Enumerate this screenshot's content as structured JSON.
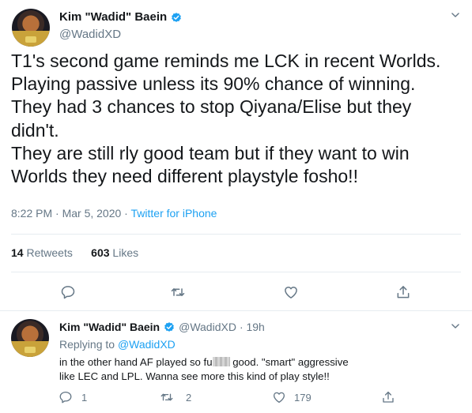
{
  "main_tweet": {
    "author": {
      "display_name": "Kim \"Wadid\" Baein",
      "handle": "@WadidXD",
      "verified": true
    },
    "text_lines": [
      "T1's second game reminds me LCK in recent Worlds.",
      "Playing passive unless its 90% chance of winning.",
      "They had 3 chances to stop Qiyana/Elise but they didn't.",
      "They are still rly good team but if they want to win Worlds they need different playstyle fosho!!"
    ],
    "time": "8:22 PM · Mar 5, 2020",
    "separator": " · ",
    "source": "Twitter for iPhone",
    "retweets_count": "14",
    "retweets_label": "Retweets",
    "likes_count": "603",
    "likes_label": "Likes"
  },
  "reply_tweet": {
    "author": {
      "display_name": "Kim \"Wadid\" Baein",
      "handle": "@WadidXD",
      "verified": true
    },
    "age": "· 19h",
    "replying_to_label": "Replying to",
    "replying_to_handle": "@WadidXD",
    "text_before_censor": "in the other hand AF played so fu",
    "text_after_censor": " good. \"smart\" aggressive like LEC and LPL. Wanna see more this kind of play style!!",
    "reply_count": "1",
    "retweet_count": "2",
    "like_count": "179"
  },
  "icons": [
    "verified-badge-icon",
    "chevron-down-icon",
    "reply-icon",
    "retweet-icon",
    "like-icon",
    "share-icon"
  ],
  "colors": {
    "accent": "#1da1f2",
    "text": "#14171a",
    "muted": "#657786",
    "divider": "#e6ecf0"
  }
}
